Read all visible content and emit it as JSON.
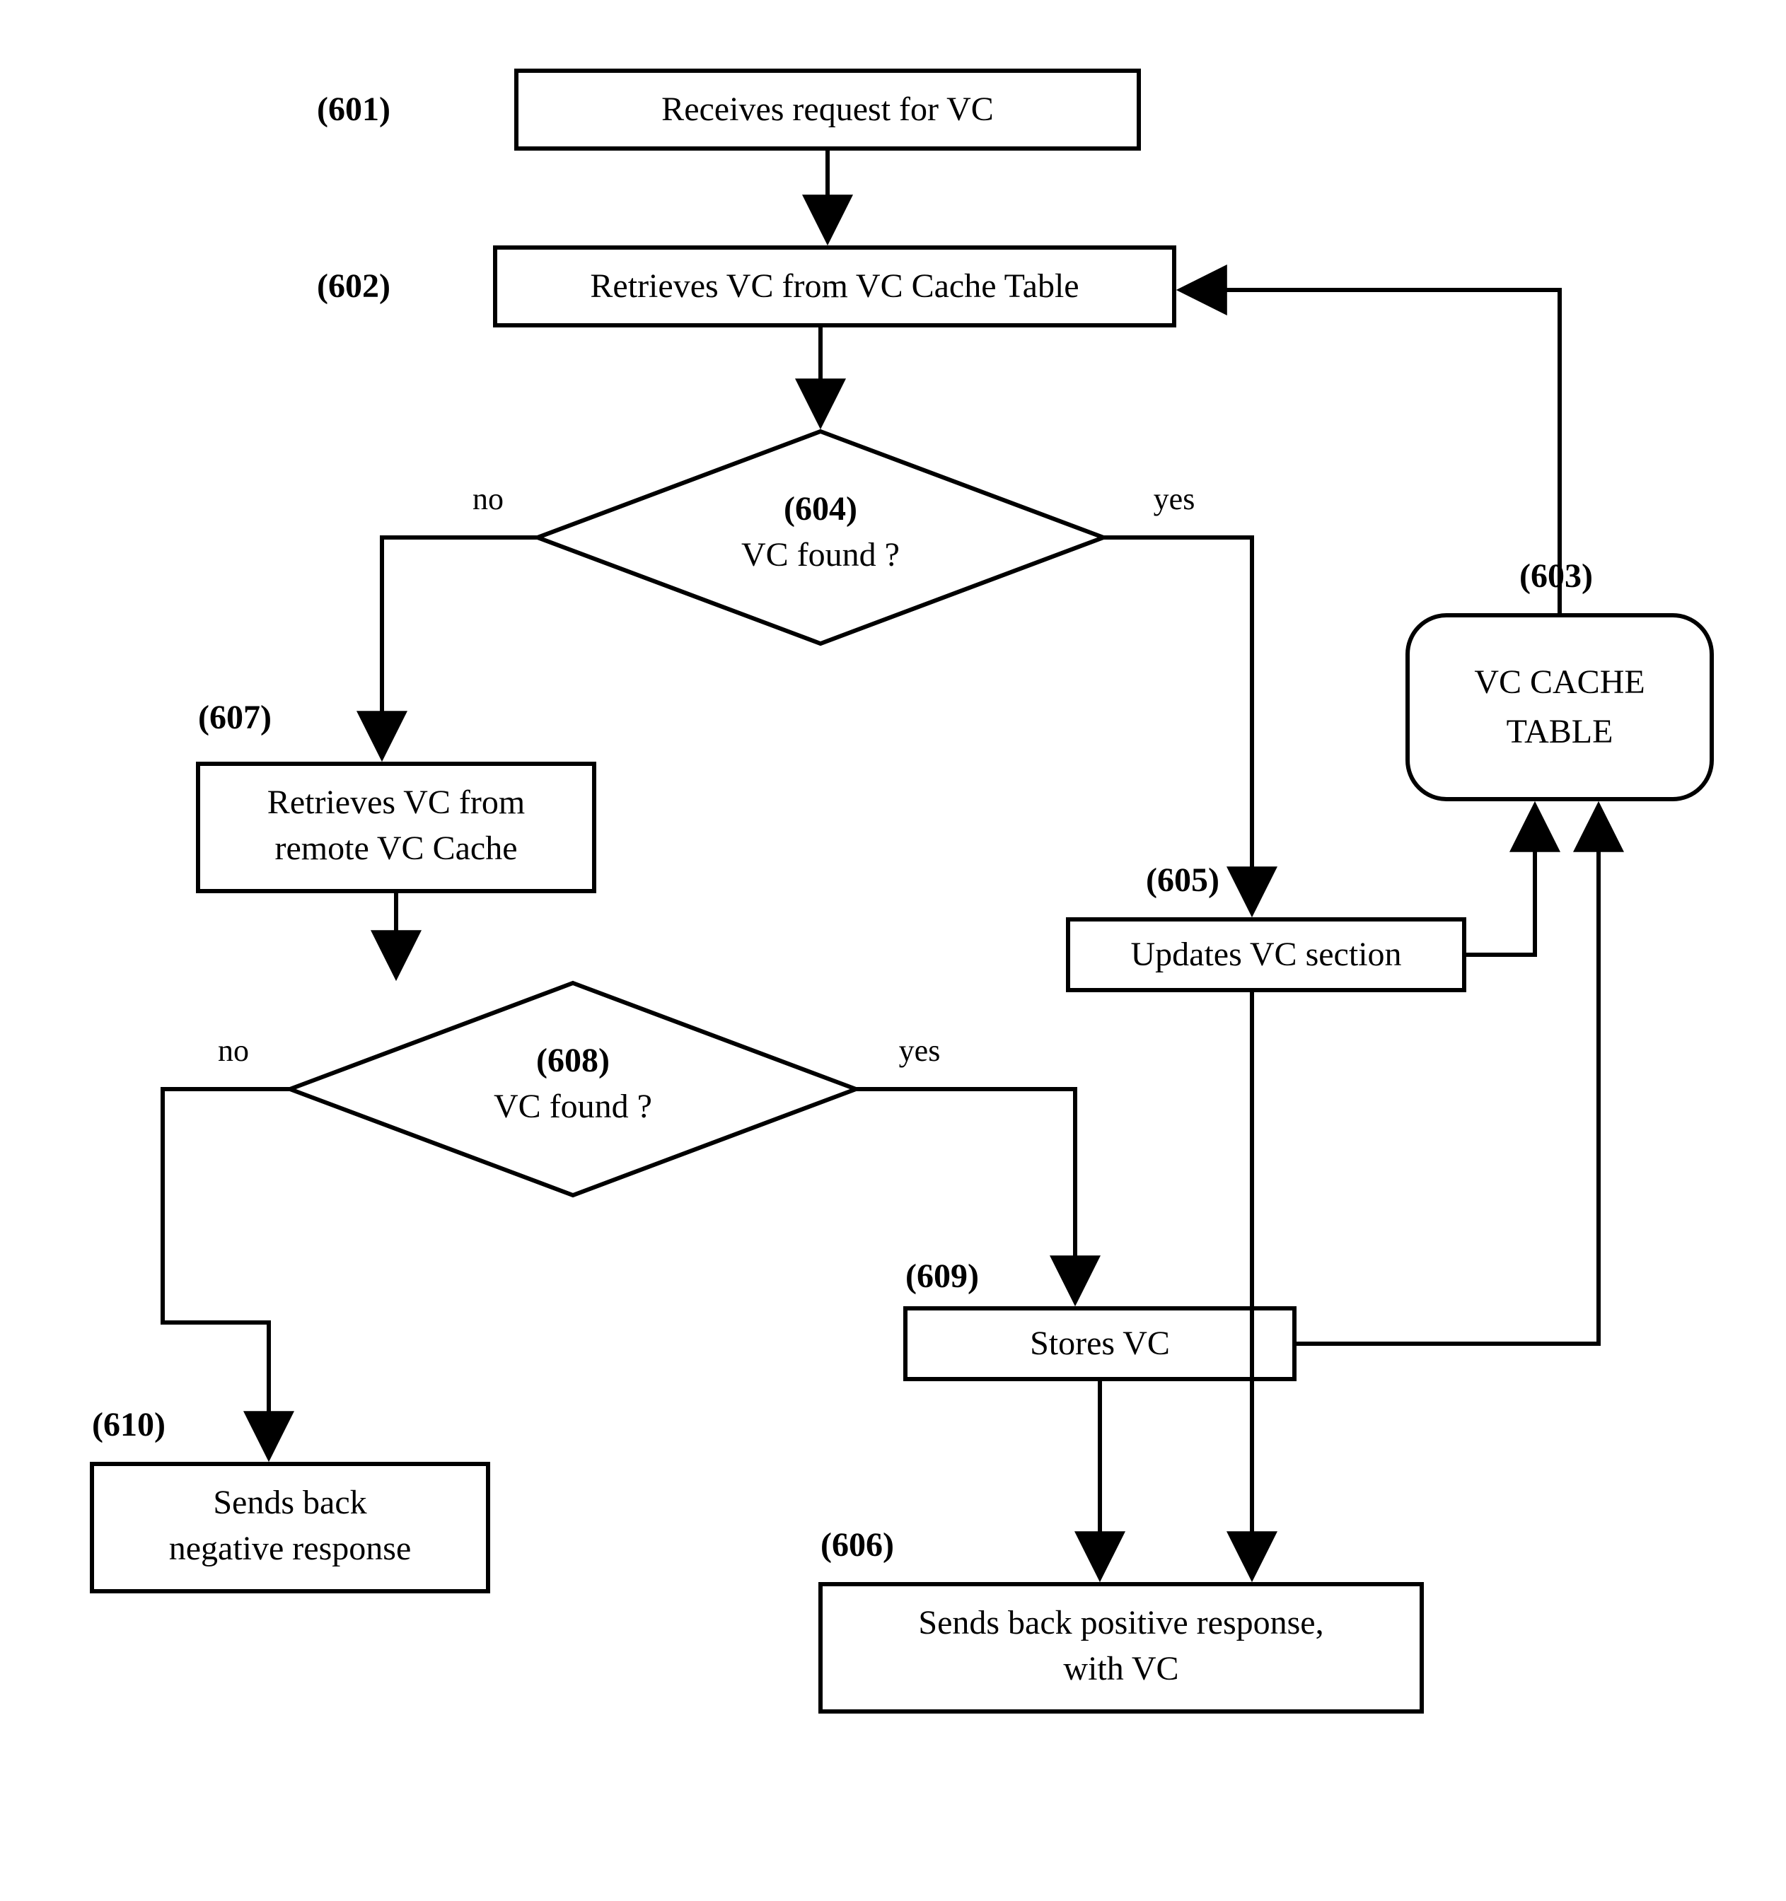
{
  "nodes": {
    "n601": {
      "label": "(601)",
      "text": "Receives request for VC"
    },
    "n602": {
      "label": "(602)",
      "text": "Retrieves VC from VC Cache Table"
    },
    "n603": {
      "label": "(603)",
      "line1": "VC CACHE",
      "line2": "TABLE"
    },
    "n604": {
      "label": "(604)",
      "text": "VC found ?"
    },
    "n605": {
      "label": "(605)",
      "text": "Updates VC section"
    },
    "n606": {
      "label": "(606)",
      "line1": "Sends back positive response,",
      "line2": "with VC"
    },
    "n607": {
      "label": "(607)",
      "line1": "Retrieves VC from",
      "line2": "remote VC Cache"
    },
    "n608": {
      "label": "(608)",
      "text": "VC found ?"
    },
    "n609": {
      "label": "(609)",
      "text": "Stores VC"
    },
    "n610": {
      "label": "(610)",
      "line1": "Sends back",
      "line2": "negative response"
    }
  },
  "edges": {
    "no": "no",
    "yes": "yes"
  }
}
